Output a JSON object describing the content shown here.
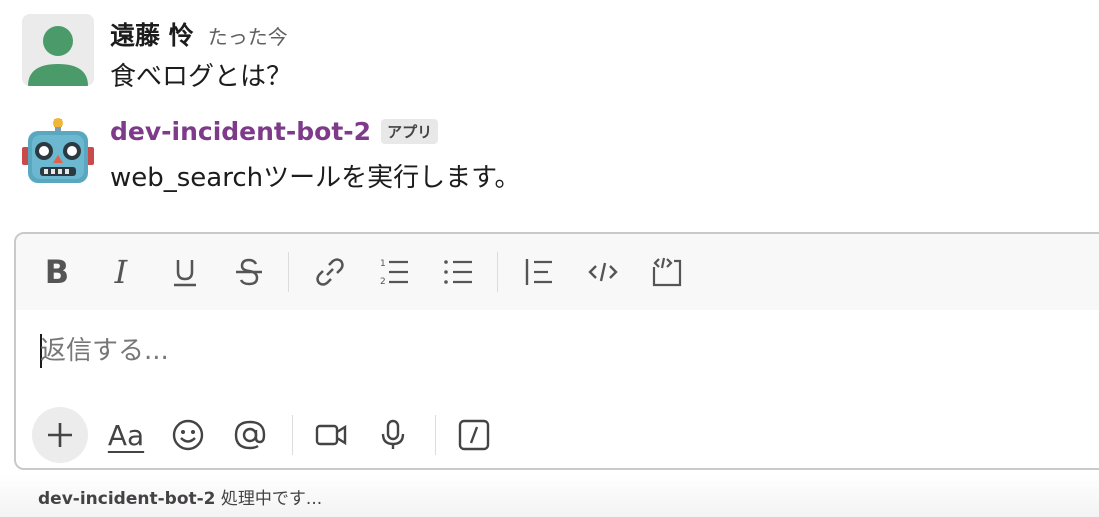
{
  "messages": [
    {
      "author": "遠藤 怜",
      "timestamp": "たった今",
      "text": "食べログとは？",
      "avatar": "person-avatar"
    },
    {
      "author": "dev-incident-bot-2",
      "badge": "アプリ",
      "text": "web_searchツールを実行します。",
      "avatar": "robot-avatar"
    }
  ],
  "composer": {
    "placeholder": "返信する...",
    "value": "",
    "format_toolbar": [
      "bold-icon",
      "italic-icon",
      "underline-icon",
      "strikethrough-icon",
      "link-icon",
      "ordered-list-icon",
      "bulleted-list-icon",
      "blockquote-icon",
      "code-icon",
      "code-block-icon"
    ],
    "bottom_toolbar": [
      "plus-icon",
      "text-format-icon",
      "emoji-icon",
      "mention-icon",
      "video-icon",
      "microphone-icon",
      "slash-command-icon"
    ],
    "text_format_label": "Aa"
  },
  "status": {
    "bot": "dev-incident-bot-2",
    "text": "処理中です..."
  },
  "colors": {
    "bot_name": "#7e3b8a",
    "avatar_person": "#4a9a6a",
    "robot_face": "#5aa7c0"
  }
}
